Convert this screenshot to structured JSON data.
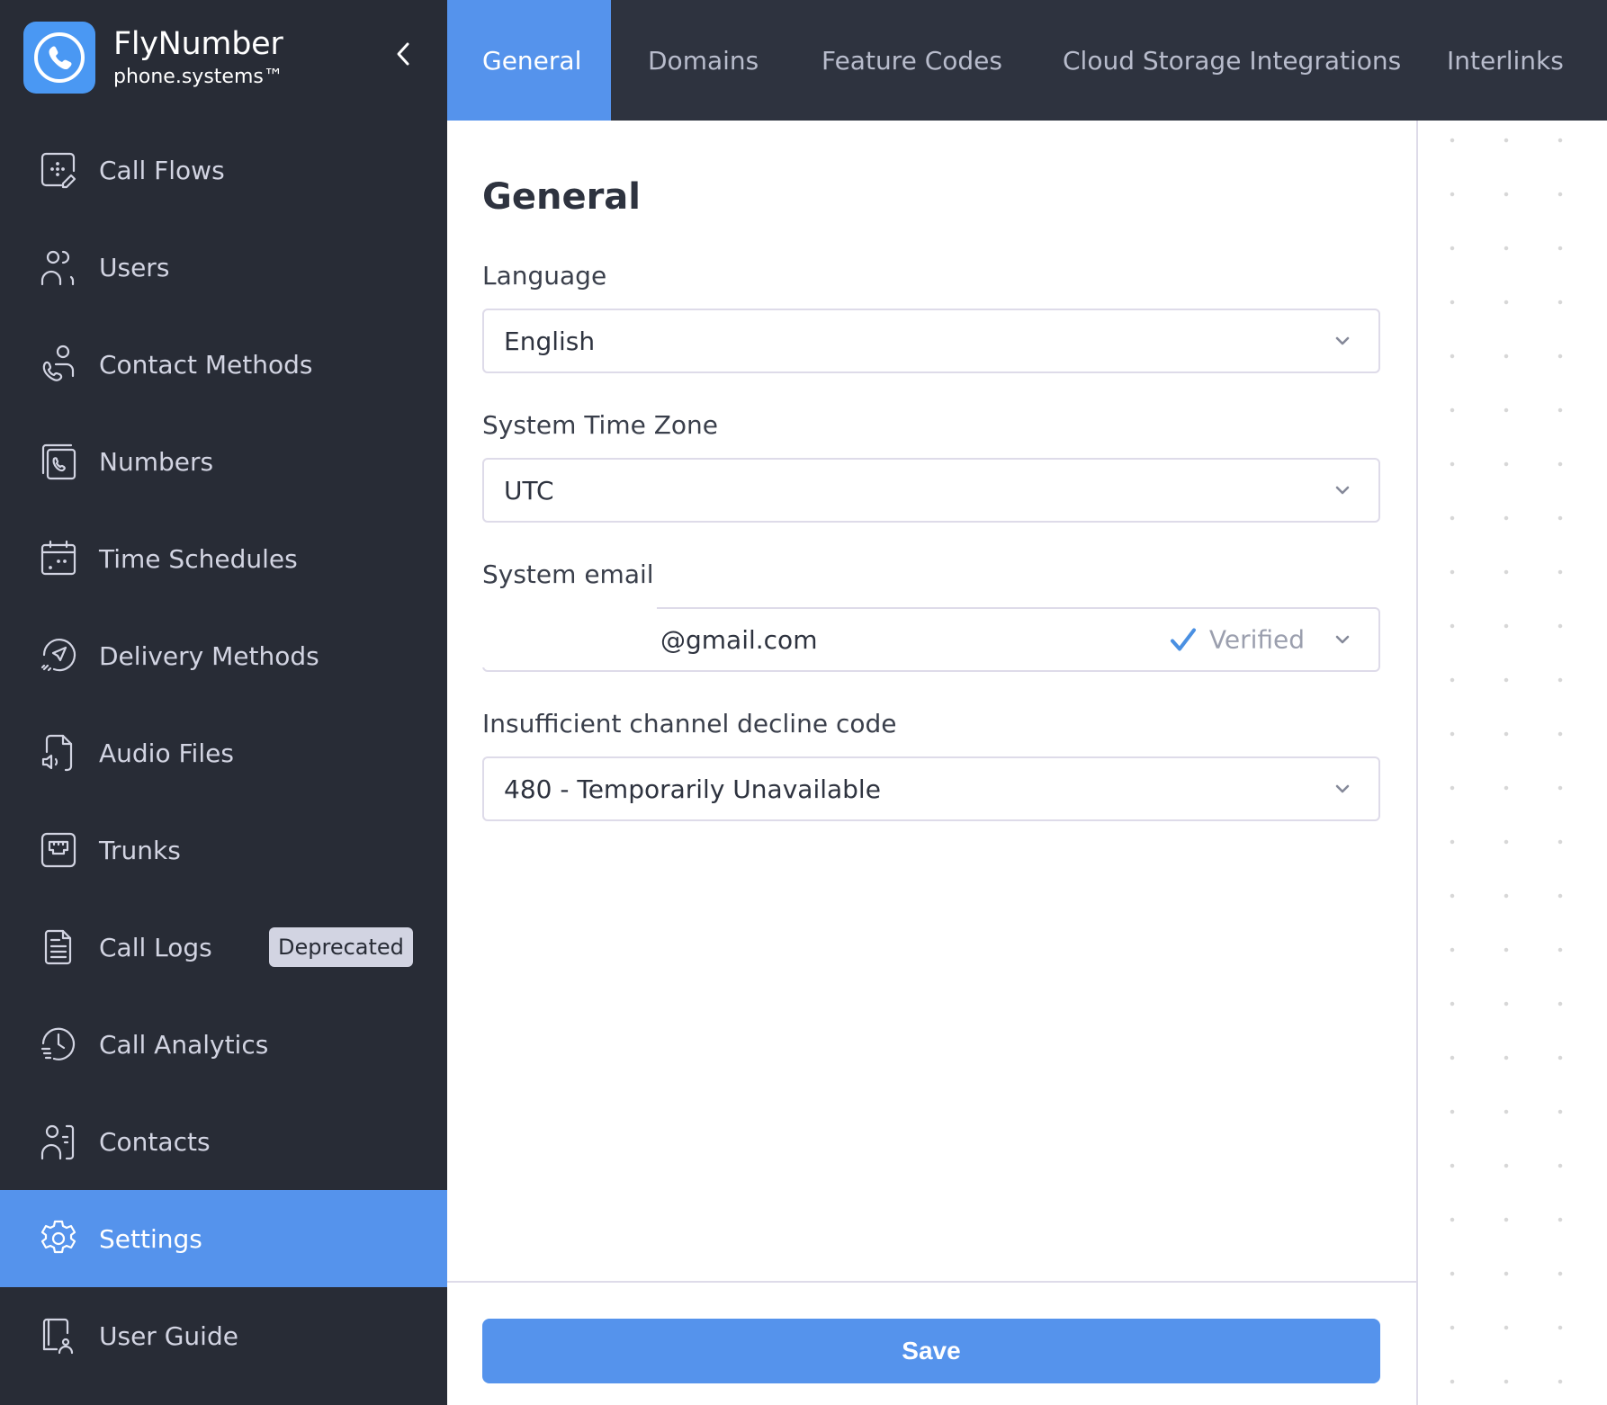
{
  "brand": {
    "name": "FlyNumber",
    "subtitle": "phone.systems™",
    "logo_icon": "phone-circle-icon",
    "collapse_icon": "chevron-left-icon"
  },
  "sidebar": {
    "items": [
      {
        "label": "Call Flows",
        "icon": "call-flows-icon"
      },
      {
        "label": "Users",
        "icon": "users-icon"
      },
      {
        "label": "Contact Methods",
        "icon": "contact-methods-icon"
      },
      {
        "label": "Numbers",
        "icon": "numbers-icon"
      },
      {
        "label": "Time Schedules",
        "icon": "calendar-icon"
      },
      {
        "label": "Delivery Methods",
        "icon": "send-icon"
      },
      {
        "label": "Audio Files",
        "icon": "audio-file-icon"
      },
      {
        "label": "Trunks",
        "icon": "trunks-icon"
      },
      {
        "label": "Call Logs",
        "icon": "document-icon",
        "badge": "Deprecated"
      },
      {
        "label": "Call Analytics",
        "icon": "clock-analytics-icon"
      },
      {
        "label": "Contacts",
        "icon": "contacts-icon"
      },
      {
        "label": "Settings",
        "icon": "gear-icon",
        "active": true
      },
      {
        "label": "User Guide",
        "icon": "user-guide-icon"
      }
    ]
  },
  "tabs": [
    {
      "label": "General",
      "active": true
    },
    {
      "label": "Domains"
    },
    {
      "label": "Feature Codes"
    },
    {
      "label": "Cloud Storage Integrations"
    },
    {
      "label": "Interlinks"
    }
  ],
  "main": {
    "title": "General",
    "fields": {
      "language": {
        "label": "Language",
        "value": "English"
      },
      "timezone": {
        "label": "System Time Zone",
        "value": "UTC"
      },
      "email": {
        "label": "System email",
        "value": "@gmail.com",
        "status": "Verified"
      },
      "decline_code": {
        "label": "Insufficient channel decline code",
        "value": "480 - Temporarily Unavailable"
      }
    },
    "save_label": "Save"
  },
  "colors": {
    "accent": "#5593ec",
    "sidebar_bg": "#282c36",
    "topbar_bg": "#2e333f",
    "verified": "#4a90e2"
  }
}
